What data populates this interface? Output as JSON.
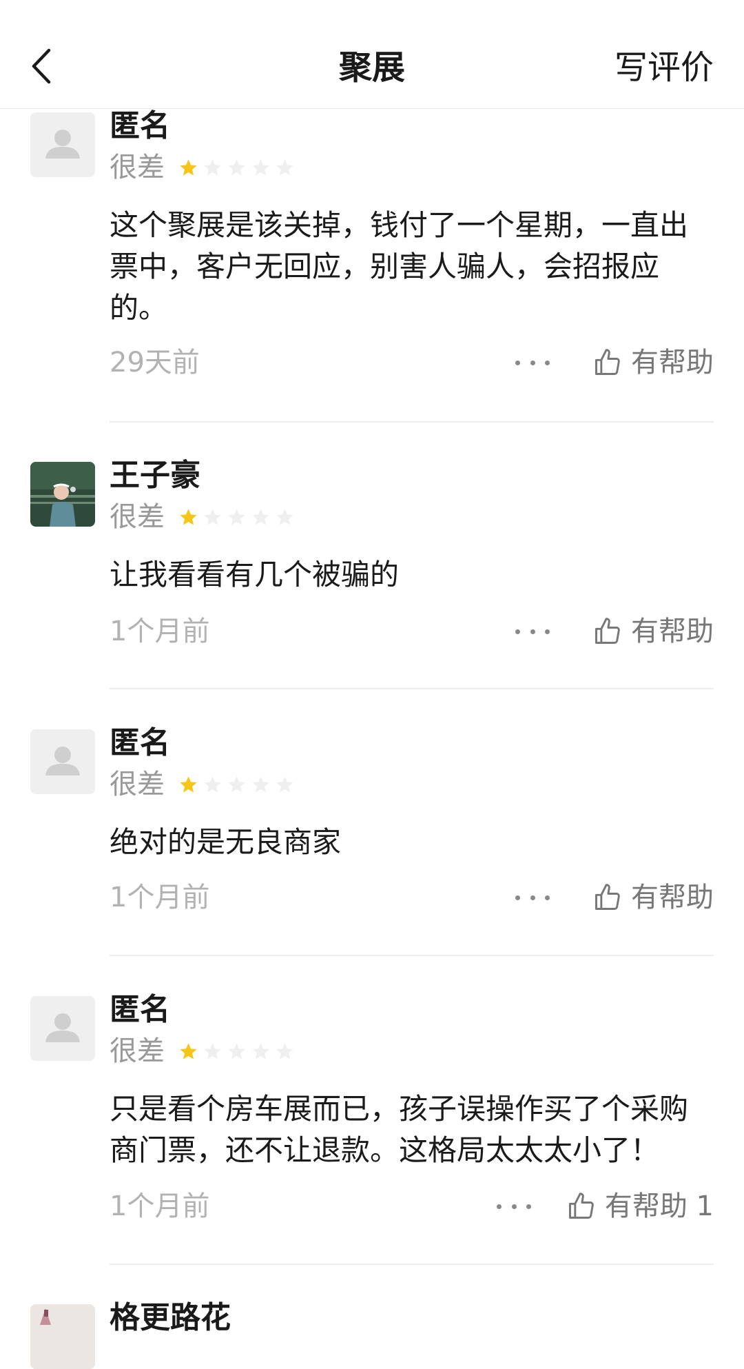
{
  "header": {
    "title": "聚展",
    "write_review": "写评价",
    "back_icon": "chevron-left-icon"
  },
  "colors": {
    "star_filled": "#F5C518",
    "star_empty": "#EFEFEF",
    "muted_text": "#999999"
  },
  "reviews": [
    {
      "user": "匿名",
      "rating_label": "很差",
      "stars": 1,
      "text": "这个聚展是该关掉，钱付了一个星期，一直出票中，客户无回应，别害人骗人，会招报应的。",
      "time": "29天前",
      "helpful": "有帮助"
    },
    {
      "user": "王子豪",
      "rating_label": "很差",
      "stars": 1,
      "text": "让我看看有几个被骗的",
      "time": "1个月前",
      "helpful": "有帮助"
    },
    {
      "user": "匿名",
      "rating_label": "很差",
      "stars": 1,
      "text": "绝对的是无良商家",
      "time": "1个月前",
      "helpful": "有帮助"
    },
    {
      "user": "匿名",
      "rating_label": "很差",
      "stars": 1,
      "text": "只是看个房车展而已，孩子误操作买了个采购商门票，还不让退款。这格局太太太小了！",
      "time": "1个月前",
      "helpful": "有帮助 1"
    },
    {
      "user": "格更路花"
    }
  ]
}
